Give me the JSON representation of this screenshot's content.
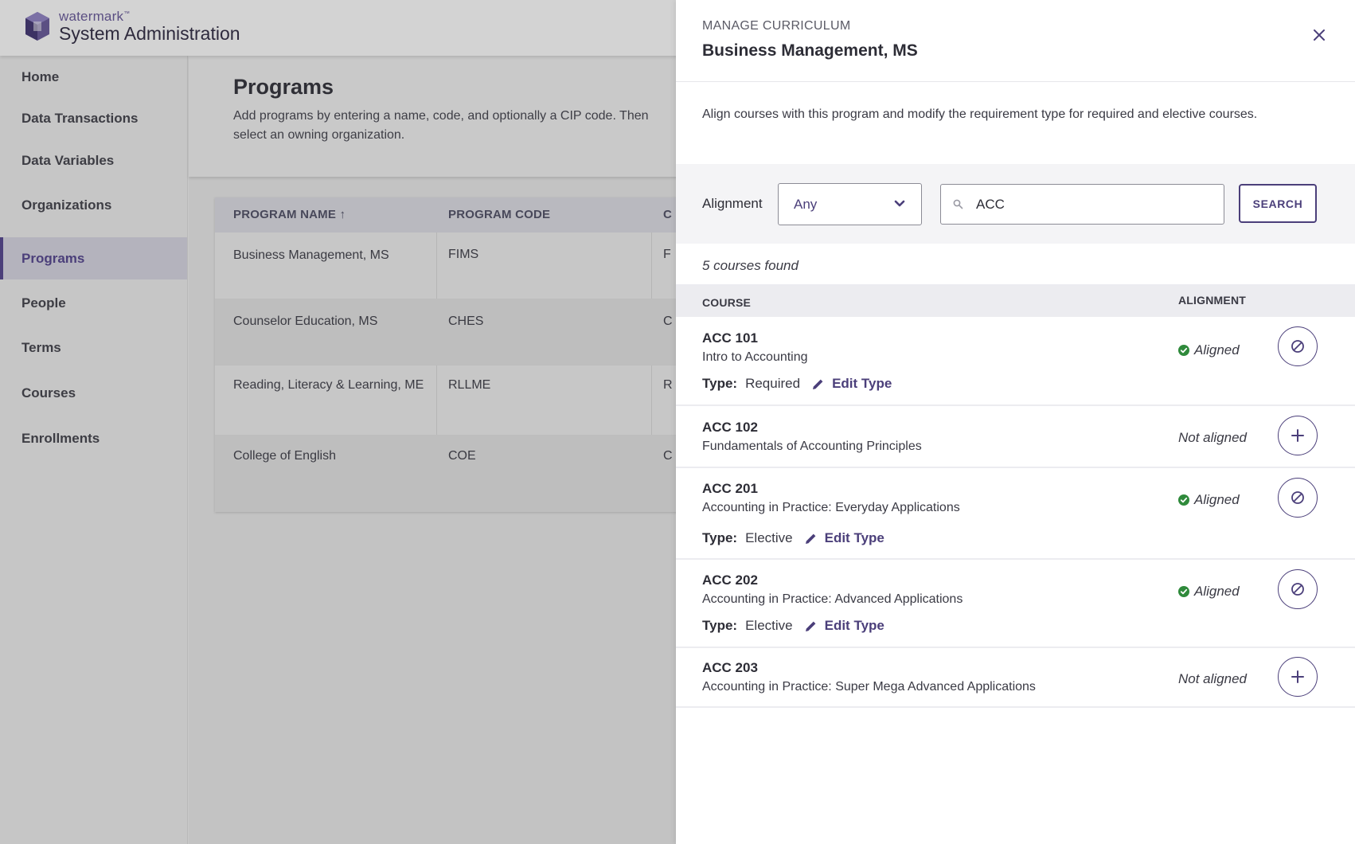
{
  "app": {
    "brand": "watermark",
    "brand_tm": "™",
    "title": "System Administration"
  },
  "sidebar": {
    "items": [
      {
        "label": "Home",
        "active": false
      },
      {
        "label": "Data Transactions",
        "active": false
      },
      {
        "label": "Data Variables",
        "active": false
      },
      {
        "label": "Organizations",
        "active": false
      },
      {
        "label": "Programs",
        "active": true
      },
      {
        "label": "People",
        "active": false
      },
      {
        "label": "Terms",
        "active": false
      },
      {
        "label": "Courses",
        "active": false
      },
      {
        "label": "Enrollments",
        "active": false
      }
    ]
  },
  "page": {
    "title": "Programs",
    "description": "Add programs by entering a name, code, and optionally a CIP code. Then select an owning organization."
  },
  "programs_table": {
    "columns": [
      "PROGRAM NAME",
      "PROGRAM CODE",
      "C"
    ],
    "sort_indicator": "↑",
    "rows": [
      {
        "name": "Business Management, MS",
        "code": "FIMS",
        "third": "F"
      },
      {
        "name": "Counselor Education, MS",
        "code": "CHES",
        "third": "C"
      },
      {
        "name": "Reading, Literacy & Learning, ME",
        "code": "RLLME",
        "third": "R"
      },
      {
        "name": "College of English",
        "code": "COE",
        "third": "C"
      }
    ]
  },
  "drawer": {
    "eyebrow": "MANAGE CURRICULUM",
    "title": "Business Management, MS",
    "close_icon": "close-icon",
    "description": "Align courses with this program and modify the requirement type for required and elective courses.",
    "filter": {
      "alignment_label": "Alignment",
      "alignment_value": "Any",
      "search_value": "ACC",
      "search_button": "SEARCH"
    },
    "results_count": "5 courses found",
    "columns": {
      "course": "COURSE",
      "alignment": "ALIGNMENT"
    },
    "type_label": "Type:",
    "edit_type_label": "Edit Type",
    "courses": [
      {
        "code": "ACC 101",
        "name": "Intro to Accounting",
        "type": "Required",
        "status": "Aligned",
        "aligned": true
      },
      {
        "code": "ACC 102",
        "name": "Fundamentals of Accounting Principles",
        "type": "",
        "status": "Not aligned",
        "aligned": false
      },
      {
        "code": "ACC 201",
        "name": "Accounting in Practice: Everyday Applications",
        "type": "Elective",
        "status": "Aligned",
        "aligned": true
      },
      {
        "code": "ACC 202",
        "name": "Accounting in Practice: Advanced Applications",
        "type": "Elective",
        "status": "Aligned",
        "aligned": true
      },
      {
        "code": "ACC 203",
        "name": "Accounting in Practice: Super Mega Advanced Applications",
        "type": "",
        "status": "Not aligned",
        "aligned": false
      }
    ]
  },
  "colors": {
    "accent": "#4b3f7a",
    "aligned_green": "#2f8a3b",
    "overlay_gray": "#c3c3c3"
  }
}
